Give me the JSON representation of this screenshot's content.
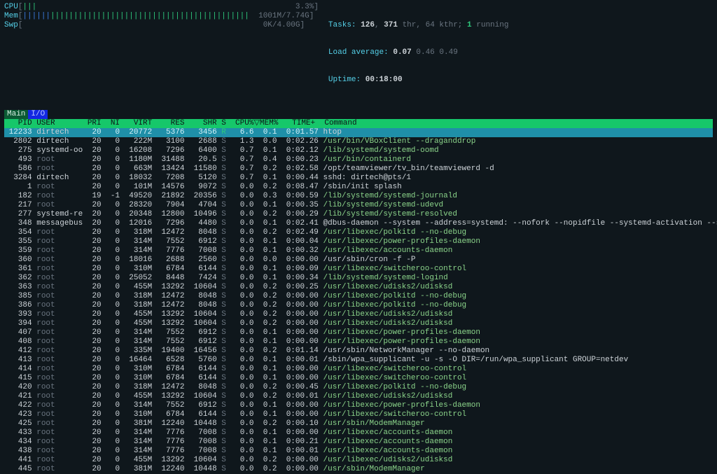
{
  "meters": {
    "cpu": {
      "label": "CPU",
      "bar": "|||",
      "pct": "3.3%"
    },
    "mem": {
      "label": "Mem",
      "bar_blue": "||||||",
      "bar_green": "|||||||||||||||||||||||||||||||||||||||||||",
      "used": "1001M",
      "total": "7.74G"
    },
    "swp": {
      "label": "Swp",
      "used": "0K",
      "total": "4.00G"
    }
  },
  "stats": {
    "tasks_label": "Tasks:",
    "tasks": "126",
    "thr": "371",
    "thr_label": "thr,",
    "kthr": "64",
    "kthr_label": "kthr;",
    "running": "1",
    "running_label": "running",
    "la_label": "Load average:",
    "la1": "0.07",
    "la5": "0.46",
    "la15": "0.49",
    "uptime_label": "Uptime:",
    "uptime": "00:18:00"
  },
  "tabs": {
    "main": "Main",
    "io": "I/O"
  },
  "columns": [
    "  PID",
    "USER     ",
    "PRI",
    " NI",
    " VIRT",
    "  RES",
    "  SHR",
    "S",
    " CPU%",
    "MEM%",
    "  TIME+ ",
    "Command"
  ],
  "rows": [
    {
      "pid": "12233",
      "user": "dirtech",
      "pri": "20",
      "ni": "0",
      "virt": "20772",
      "res": "5376",
      "shr": "3456",
      "s": "R",
      "cpu": "6.6",
      "mem": "0.1",
      "time": "0:01.57",
      "cmd": "htop",
      "style": "hl",
      "cmdc": "plain"
    },
    {
      "pid": "2802",
      "user": "dirtech",
      "pri": "20",
      "ni": "0",
      "virt": "222M",
      "res": "3100",
      "shr": "2688",
      "s": "S",
      "cpu": "1.3",
      "mem": "0.0",
      "time": "0:02.26",
      "cmd": "/usr/bin/VBoxClient --draganddrop",
      "cmdc": "bin"
    },
    {
      "pid": "275",
      "user": "systemd-oo",
      "pri": "20",
      "ni": "0",
      "virt": "16208",
      "res": "7296",
      "shr": "6400",
      "s": "S",
      "cpu": "0.7",
      "mem": "0.1",
      "time": "0:02.12",
      "cmd": "/lib/systemd/systemd-oomd",
      "cmdc": "bin"
    },
    {
      "pid": "493",
      "user": "root",
      "pri": "20",
      "ni": "0",
      "virt": "1180M",
      "res": "31488",
      "shr": "20.5",
      "s": "S",
      "cpu": "0.7",
      "mem": "0.4",
      "time": "0:00.23",
      "cmd": "/usr/bin/containerd",
      "cmdc": "bin"
    },
    {
      "pid": "586",
      "user": "root",
      "pri": "20",
      "ni": "0",
      "virt": "663M",
      "res": "13424",
      "shr": "11580",
      "s": "S",
      "cpu": "0.7",
      "mem": "0.2",
      "time": "0:02.58",
      "cmd": "/opt/teamviewer/tv_bin/teamviewerd -d",
      "cmdc": "plain"
    },
    {
      "pid": "3284",
      "user": "dirtech",
      "pri": "20",
      "ni": "0",
      "virt": "18032",
      "res": "7208",
      "shr": "5120",
      "s": "S",
      "cpu": "0.7",
      "mem": "0.1",
      "time": "0:00.44",
      "cmd": "sshd: dirtech@pts/1",
      "cmdc": "plain"
    },
    {
      "pid": "1",
      "user": "root",
      "pri": "20",
      "ni": "0",
      "virt": "101M",
      "res": "14576",
      "shr": "9072",
      "s": "S",
      "cpu": "0.0",
      "mem": "0.2",
      "time": "0:08.47",
      "cmd": "/sbin/init splash",
      "cmdc": "plain"
    },
    {
      "pid": "182",
      "user": "root",
      "pri": "19",
      "ni": "-1",
      "virt": "49520",
      "res": "21892",
      "shr": "20356",
      "s": "S",
      "cpu": "0.0",
      "mem": "0.3",
      "time": "0:00.59",
      "cmd": "/lib/systemd/systemd-journald",
      "cmdc": "bin"
    },
    {
      "pid": "217",
      "user": "root",
      "pri": "20",
      "ni": "0",
      "virt": "28320",
      "res": "7904",
      "shr": "4704",
      "s": "S",
      "cpu": "0.0",
      "mem": "0.1",
      "time": "0:00.35",
      "cmd": "/lib/systemd/systemd-udevd",
      "cmdc": "bin"
    },
    {
      "pid": "277",
      "user": "systemd-re",
      "pri": "20",
      "ni": "0",
      "virt": "20348",
      "res": "12800",
      "shr": "10496",
      "s": "S",
      "cpu": "0.0",
      "mem": "0.2",
      "time": "0:00.29",
      "cmd": "/lib/systemd/systemd-resolved",
      "cmdc": "bin"
    },
    {
      "pid": "348",
      "user": "messagebus",
      "pri": "20",
      "ni": "0",
      "virt": "12016",
      "res": "7296",
      "shr": "4480",
      "s": "S",
      "cpu": "0.0",
      "mem": "0.1",
      "time": "0:02.41",
      "cmd": "@dbus-daemon --system --address=systemd: --nofork --nopidfile --systemd-activation --s",
      "cmdc": "plain"
    },
    {
      "pid": "354",
      "user": "root",
      "pri": "20",
      "ni": "0",
      "virt": "318M",
      "res": "12472",
      "shr": "8048",
      "s": "S",
      "cpu": "0.0",
      "mem": "0.2",
      "time": "0:02.49",
      "cmd": "/usr/libexec/polkitd --no-debug",
      "cmdc": "bin"
    },
    {
      "pid": "355",
      "user": "root",
      "pri": "20",
      "ni": "0",
      "virt": "314M",
      "res": "7552",
      "shr": "6912",
      "s": "S",
      "cpu": "0.0",
      "mem": "0.1",
      "time": "0:00.04",
      "cmd": "/usr/libexec/power-profiles-daemon",
      "cmdc": "bin"
    },
    {
      "pid": "359",
      "user": "root",
      "pri": "20",
      "ni": "0",
      "virt": "314M",
      "res": "7776",
      "shr": "7008",
      "s": "S",
      "cpu": "0.0",
      "mem": "0.1",
      "time": "0:00.32",
      "cmd": "/usr/libexec/accounts-daemon",
      "cmdc": "bin"
    },
    {
      "pid": "360",
      "user": "root",
      "pri": "20",
      "ni": "0",
      "virt": "18016",
      "res": "2688",
      "shr": "2560",
      "s": "S",
      "cpu": "0.0",
      "mem": "0.0",
      "time": "0:00.00",
      "cmd": "/usr/sbin/cron -f -P",
      "cmdc": "plain"
    },
    {
      "pid": "361",
      "user": "root",
      "pri": "20",
      "ni": "0",
      "virt": "310M",
      "res": "6784",
      "shr": "6144",
      "s": "S",
      "cpu": "0.0",
      "mem": "0.1",
      "time": "0:00.09",
      "cmd": "/usr/libexec/switcheroo-control",
      "cmdc": "bin"
    },
    {
      "pid": "362",
      "user": "root",
      "pri": "20",
      "ni": "0",
      "virt": "25052",
      "res": "8448",
      "shr": "7424",
      "s": "S",
      "cpu": "0.0",
      "mem": "0.1",
      "time": "0:00.34",
      "cmd": "/lib/systemd/systemd-logind",
      "cmdc": "bin"
    },
    {
      "pid": "363",
      "user": "root",
      "pri": "20",
      "ni": "0",
      "virt": "455M",
      "res": "13292",
      "shr": "10604",
      "s": "S",
      "cpu": "0.0",
      "mem": "0.2",
      "time": "0:00.25",
      "cmd": "/usr/libexec/udisks2/udisksd",
      "cmdc": "bin"
    },
    {
      "pid": "385",
      "user": "root",
      "pri": "20",
      "ni": "0",
      "virt": "318M",
      "res": "12472",
      "shr": "8048",
      "s": "S",
      "cpu": "0.0",
      "mem": "0.2",
      "time": "0:00.00",
      "cmd": "/usr/libexec/polkitd --no-debug",
      "cmdc": "bin"
    },
    {
      "pid": "386",
      "user": "root",
      "pri": "20",
      "ni": "0",
      "virt": "318M",
      "res": "12472",
      "shr": "8048",
      "s": "S",
      "cpu": "0.0",
      "mem": "0.2",
      "time": "0:00.00",
      "cmd": "/usr/libexec/polkitd --no-debug",
      "cmdc": "bin"
    },
    {
      "pid": "393",
      "user": "root",
      "pri": "20",
      "ni": "0",
      "virt": "455M",
      "res": "13292",
      "shr": "10604",
      "s": "S",
      "cpu": "0.0",
      "mem": "0.2",
      "time": "0:00.00",
      "cmd": "/usr/libexec/udisks2/udisksd",
      "cmdc": "bin"
    },
    {
      "pid": "394",
      "user": "root",
      "pri": "20",
      "ni": "0",
      "virt": "455M",
      "res": "13292",
      "shr": "10604",
      "s": "S",
      "cpu": "0.0",
      "mem": "0.2",
      "time": "0:00.00",
      "cmd": "/usr/libexec/udisks2/udisksd",
      "cmdc": "bin"
    },
    {
      "pid": "407",
      "user": "root",
      "pri": "20",
      "ni": "0",
      "virt": "314M",
      "res": "7552",
      "shr": "6912",
      "s": "S",
      "cpu": "0.0",
      "mem": "0.1",
      "time": "0:00.00",
      "cmd": "/usr/libexec/power-profiles-daemon",
      "cmdc": "bin"
    },
    {
      "pid": "408",
      "user": "root",
      "pri": "20",
      "ni": "0",
      "virt": "314M",
      "res": "7552",
      "shr": "6912",
      "s": "S",
      "cpu": "0.0",
      "mem": "0.1",
      "time": "0:00.00",
      "cmd": "/usr/libexec/power-profiles-daemon",
      "cmdc": "bin"
    },
    {
      "pid": "412",
      "user": "root",
      "pri": "20",
      "ni": "0",
      "virt": "335M",
      "res": "19400",
      "shr": "16456",
      "s": "S",
      "cpu": "0.0",
      "mem": "0.2",
      "time": "0:01.14",
      "cmd": "/usr/sbin/NetworkManager --no-daemon",
      "cmdc": "plain"
    },
    {
      "pid": "413",
      "user": "root",
      "pri": "20",
      "ni": "0",
      "virt": "16464",
      "res": "6528",
      "shr": "5760",
      "s": "S",
      "cpu": "0.0",
      "mem": "0.1",
      "time": "0:00.01",
      "cmd": "/sbin/wpa_supplicant -u -s -O DIR=/run/wpa_supplicant GROUP=netdev",
      "cmdc": "plain"
    },
    {
      "pid": "414",
      "user": "root",
      "pri": "20",
      "ni": "0",
      "virt": "310M",
      "res": "6784",
      "shr": "6144",
      "s": "S",
      "cpu": "0.0",
      "mem": "0.1",
      "time": "0:00.00",
      "cmd": "/usr/libexec/switcheroo-control",
      "cmdc": "bin"
    },
    {
      "pid": "415",
      "user": "root",
      "pri": "20",
      "ni": "0",
      "virt": "310M",
      "res": "6784",
      "shr": "6144",
      "s": "S",
      "cpu": "0.0",
      "mem": "0.1",
      "time": "0:00.00",
      "cmd": "/usr/libexec/switcheroo-control",
      "cmdc": "bin"
    },
    {
      "pid": "420",
      "user": "root",
      "pri": "20",
      "ni": "0",
      "virt": "318M",
      "res": "12472",
      "shr": "8048",
      "s": "S",
      "cpu": "0.0",
      "mem": "0.2",
      "time": "0:00.45",
      "cmd": "/usr/libexec/polkitd --no-debug",
      "cmdc": "bin"
    },
    {
      "pid": "421",
      "user": "root",
      "pri": "20",
      "ni": "0",
      "virt": "455M",
      "res": "13292",
      "shr": "10604",
      "s": "S",
      "cpu": "0.0",
      "mem": "0.2",
      "time": "0:00.01",
      "cmd": "/usr/libexec/udisks2/udisksd",
      "cmdc": "bin"
    },
    {
      "pid": "422",
      "user": "root",
      "pri": "20",
      "ni": "0",
      "virt": "314M",
      "res": "7552",
      "shr": "6912",
      "s": "S",
      "cpu": "0.0",
      "mem": "0.1",
      "time": "0:00.00",
      "cmd": "/usr/libexec/power-profiles-daemon",
      "cmdc": "bin"
    },
    {
      "pid": "423",
      "user": "root",
      "pri": "20",
      "ni": "0",
      "virt": "310M",
      "res": "6784",
      "shr": "6144",
      "s": "S",
      "cpu": "0.0",
      "mem": "0.1",
      "time": "0:00.00",
      "cmd": "/usr/libexec/switcheroo-control",
      "cmdc": "bin"
    },
    {
      "pid": "425",
      "user": "root",
      "pri": "20",
      "ni": "0",
      "virt": "381M",
      "res": "12240",
      "shr": "10448",
      "s": "S",
      "cpu": "0.0",
      "mem": "0.2",
      "time": "0:00.10",
      "cmd": "/usr/sbin/ModemManager",
      "cmdc": "bin"
    },
    {
      "pid": "433",
      "user": "root",
      "pri": "20",
      "ni": "0",
      "virt": "314M",
      "res": "7776",
      "shr": "7008",
      "s": "S",
      "cpu": "0.0",
      "mem": "0.1",
      "time": "0:00.00",
      "cmd": "/usr/libexec/accounts-daemon",
      "cmdc": "bin"
    },
    {
      "pid": "434",
      "user": "root",
      "pri": "20",
      "ni": "0",
      "virt": "314M",
      "res": "7776",
      "shr": "7008",
      "s": "S",
      "cpu": "0.0",
      "mem": "0.1",
      "time": "0:00.21",
      "cmd": "/usr/libexec/accounts-daemon",
      "cmdc": "bin"
    },
    {
      "pid": "438",
      "user": "root",
      "pri": "20",
      "ni": "0",
      "virt": "314M",
      "res": "7776",
      "shr": "7008",
      "s": "S",
      "cpu": "0.0",
      "mem": "0.1",
      "time": "0:00.01",
      "cmd": "/usr/libexec/accounts-daemon",
      "cmdc": "bin"
    },
    {
      "pid": "441",
      "user": "root",
      "pri": "20",
      "ni": "0",
      "virt": "455M",
      "res": "13292",
      "shr": "10604",
      "s": "S",
      "cpu": "0.0",
      "mem": "0.2",
      "time": "0:00.00",
      "cmd": "/usr/libexec/udisks2/udisksd",
      "cmdc": "bin"
    },
    {
      "pid": "445",
      "user": "root",
      "pri": "20",
      "ni": "0",
      "virt": "381M",
      "res": "12240",
      "shr": "10448",
      "s": "S",
      "cpu": "0.0",
      "mem": "0.2",
      "time": "0:00.00",
      "cmd": "/usr/sbin/ModemManager",
      "cmdc": "bin"
    }
  ]
}
